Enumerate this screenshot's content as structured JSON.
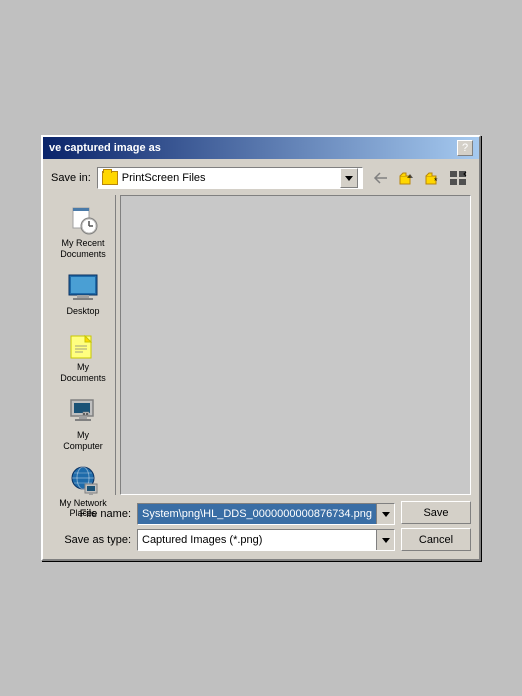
{
  "dialog": {
    "title": "ve captured image as",
    "question_mark": "?",
    "save_in_label": "Save in:",
    "folder_name": "PrintScreen Files",
    "file_name_label": "File name:",
    "file_name_value": "System\\png\\HL_DDS_0000000000876734.png",
    "save_as_type_label": "Save as type:",
    "save_as_type_value": "Captured Images (*.png)",
    "save_btn": "Save",
    "cancel_btn": "Cancel"
  },
  "sidebar": {
    "items": [
      {
        "label": "My Recent Documents",
        "icon": "recent-docs-icon"
      },
      {
        "label": "Desktop",
        "icon": "desktop-icon"
      },
      {
        "label": "My Documents",
        "icon": "my-documents-icon"
      },
      {
        "label": "My Computer",
        "icon": "my-computer-icon"
      },
      {
        "label": "My Network Places",
        "icon": "my-network-icon"
      }
    ]
  },
  "toolbar": {
    "back_tooltip": "Back",
    "up_tooltip": "Up one level",
    "new_folder_tooltip": "Create New Folder",
    "views_tooltip": "Views"
  }
}
